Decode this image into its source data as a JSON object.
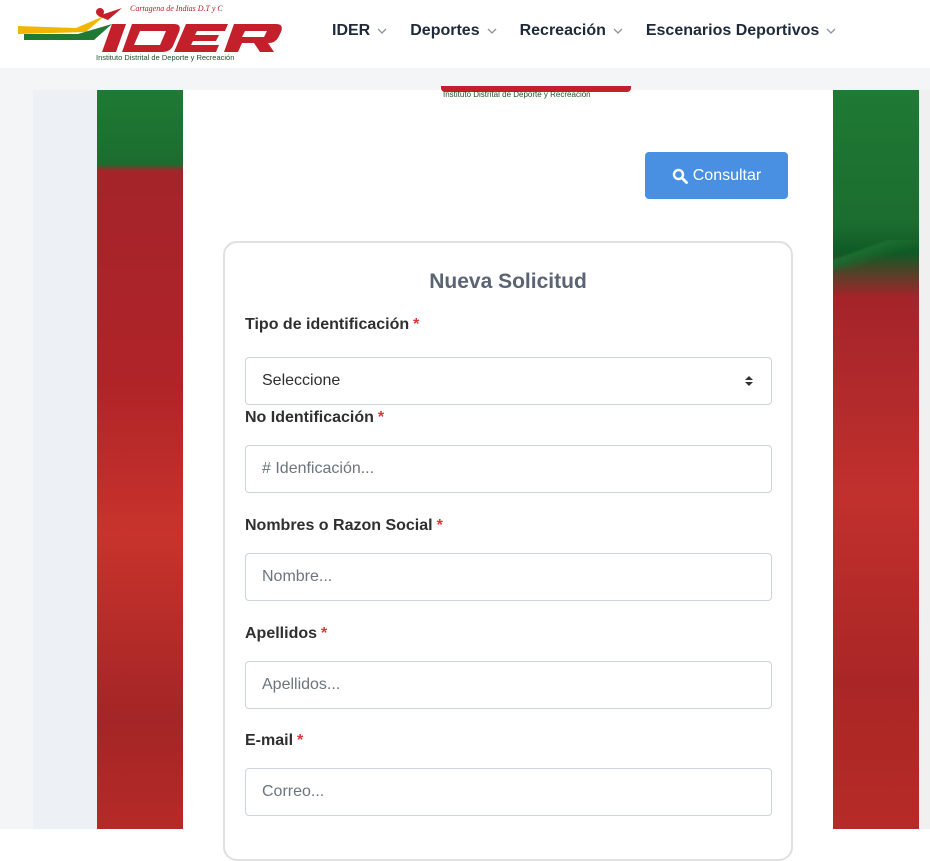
{
  "header": {
    "logo_tagline": "Cartagena de Indias D.T y C",
    "logo_subtitle": "Instituto Distrital de Deporte y Recreación",
    "nav": [
      {
        "label": "IDER"
      },
      {
        "label": "Deportes"
      },
      {
        "label": "Recreación"
      },
      {
        "label": "Escenarios Deportivos"
      }
    ]
  },
  "banner": {
    "subtitle": "Instituto Distrital de Deporte y Recreación"
  },
  "toolbar": {
    "consult_label": "Consultar"
  },
  "form": {
    "title": "Nueva Solicitud",
    "required_mark": "*",
    "id_type": {
      "label": "Tipo de identificación",
      "selected": "Seleccione"
    },
    "id_number": {
      "label": "No Identificación",
      "placeholder": "# Idenficación..."
    },
    "name": {
      "label": "Nombres o Razon Social",
      "placeholder": "Nombre..."
    },
    "surname": {
      "label": "Apellidos",
      "placeholder": "Apellidos..."
    },
    "email": {
      "label": "E-mail",
      "placeholder": "Correo..."
    }
  },
  "colors": {
    "primary_button": "#4a90e2",
    "brand_red": "#c3202b",
    "brand_green": "#1f7a34",
    "required": "#e03535"
  }
}
